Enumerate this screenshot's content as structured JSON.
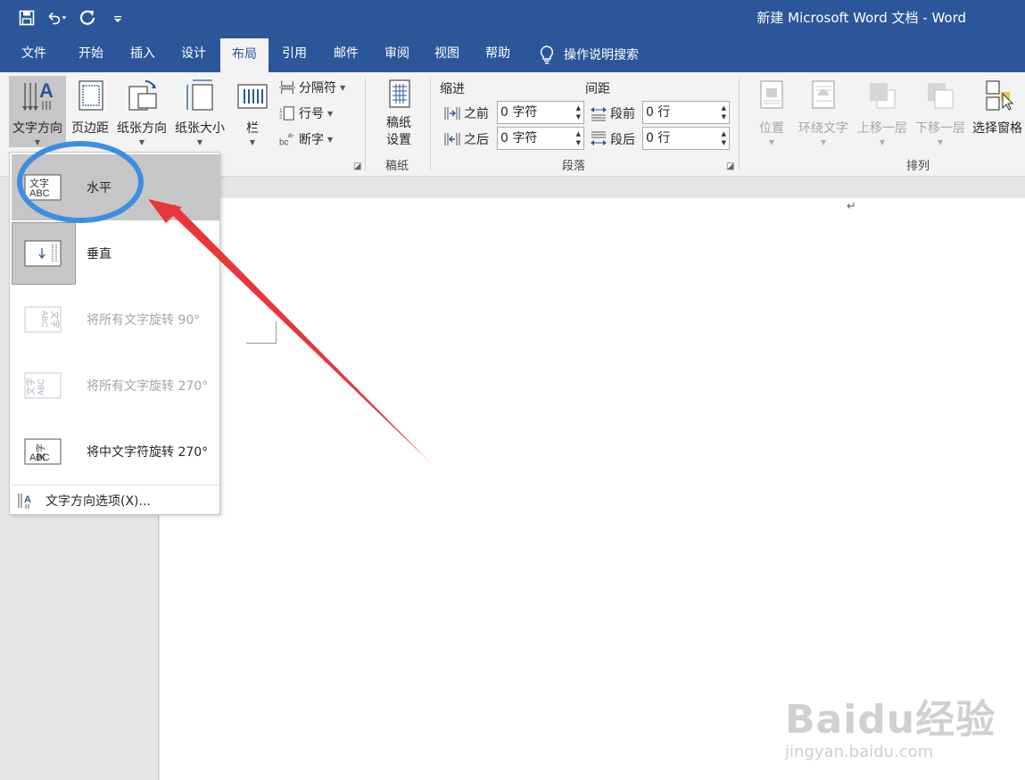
{
  "window": {
    "title": "新建 Microsoft Word 文档  -  Word"
  },
  "qat": {
    "icons": [
      "save-icon",
      "undo-icon",
      "redo-icon",
      "customize-icon"
    ]
  },
  "tabs": [
    {
      "label": "文件"
    },
    {
      "label": "开始"
    },
    {
      "label": "插入"
    },
    {
      "label": "设计"
    },
    {
      "label": "布局"
    },
    {
      "label": "引用"
    },
    {
      "label": "邮件"
    },
    {
      "label": "审阅"
    },
    {
      "label": "视图"
    },
    {
      "label": "帮助"
    }
  ],
  "active_tab": "布局",
  "tell_me": {
    "label": "操作说明搜索",
    "icon": "lightbulb-icon"
  },
  "ribbon": {
    "page_setup": {
      "text_direction": "文字方向",
      "margins": "页边距",
      "orientation": "纸张方向",
      "size": "纸张大小",
      "columns": "栏",
      "breaks": "分隔符",
      "line_numbers": "行号",
      "hyphenation": "断字"
    },
    "manuscript": {
      "button": "稿纸设置",
      "button_line1": "稿纸",
      "button_line2": "设置",
      "group": "稿纸"
    },
    "paragraph": {
      "group": "段落",
      "indent_header": "缩进",
      "spacing_header": "间距",
      "before_label": "之前",
      "after_label": "之后",
      "indent_before_value": "0 字符",
      "indent_after_value": "0 字符",
      "space_before_label": "段前",
      "space_after_label": "段后",
      "space_before_value": "0 行",
      "space_after_value": "0 行"
    },
    "arrange": {
      "group": "排列",
      "position": "位置",
      "wrap_text": "环绕文字",
      "bring_forward": "上移一层",
      "send_backward": "下移一层",
      "selection_pane": "选择窗格"
    }
  },
  "dropdown": {
    "items": [
      {
        "label": "水平",
        "icon_text": "文字 ABC",
        "state": "hover"
      },
      {
        "label": "垂直",
        "state": "selected"
      },
      {
        "label": "将所有文字旋转 90°",
        "state": "disabled"
      },
      {
        "label": "将所有文字旋转 270°",
        "state": "disabled"
      },
      {
        "label": "将中文字符旋转 270°",
        "state": "enabled"
      }
    ],
    "footer": "文字方向选项(X)..."
  },
  "watermark": {
    "logo": "Baidu经验",
    "url": "jingyan.baidu.com"
  },
  "colors": {
    "accent": "#2b579a",
    "annotation_circle": "#3b8fe0",
    "annotation_arrow": "#e8363a"
  }
}
